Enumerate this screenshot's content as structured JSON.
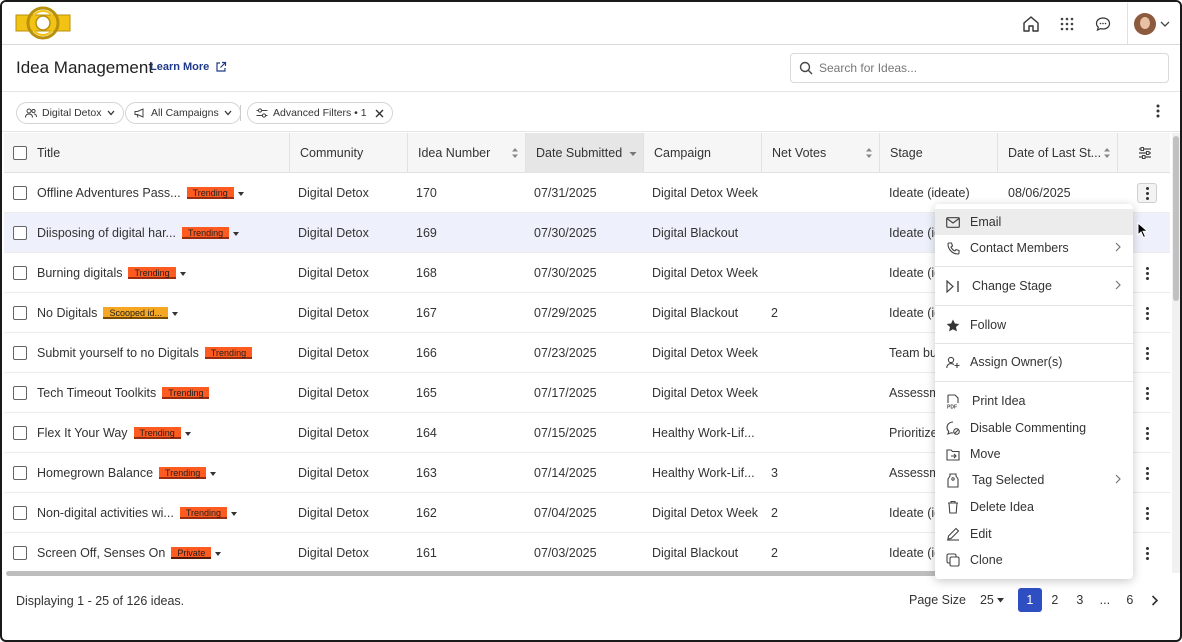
{
  "nav": {
    "home_icon": "home-icon",
    "apps_icon": "grid-icon",
    "chat_icon": "chat-icon"
  },
  "header": {
    "title": "Idea Management",
    "learn_more": "Learn More",
    "search_placeholder": "Search for Ideas..."
  },
  "filters": {
    "community": "Digital Detox",
    "campaigns": "All Campaigns",
    "advanced": "Advanced Filters • 1"
  },
  "columns": [
    "Title",
    "Community",
    "Idea Number",
    "Date Submitted",
    "Campaign",
    "Net Votes",
    "Stage",
    "Date of Last St..."
  ],
  "rows": [
    {
      "title": "Offline Adventures Pass...",
      "tag": "Trending",
      "community": "Digital Detox",
      "number": "170",
      "date": "07/31/2025",
      "campaign": "Digital Detox Week",
      "votes": "",
      "stage": "Ideate (ideate)",
      "last": "08/06/2025"
    },
    {
      "title": "Diisposing of digital har...",
      "tag": "Trending",
      "community": "Digital Detox",
      "number": "169",
      "date": "07/30/2025",
      "campaign": "Digital Blackout",
      "votes": "",
      "stage": "Ideate (ic",
      "last": ""
    },
    {
      "title": "Burning digitals",
      "tag": "Trending",
      "community": "Digital Detox",
      "number": "168",
      "date": "07/30/2025",
      "campaign": "Digital Detox Week",
      "votes": "",
      "stage": "Ideate (ic",
      "last": ""
    },
    {
      "title": "No Digitals",
      "tag": "Scooped id...",
      "community": "Digital Detox",
      "number": "167",
      "date": "07/29/2025",
      "campaign": "Digital Blackout",
      "votes": "2",
      "stage": "Ideate (ic",
      "last": ""
    },
    {
      "title": "Submit yourself to no Digitals",
      "tag": "Trending",
      "community": "Digital Detox",
      "number": "166",
      "date": "07/23/2025",
      "campaign": "Digital Detox Week",
      "votes": "",
      "stage": "Team bu",
      "last": ""
    },
    {
      "title": "Tech Timeout Toolkits",
      "tag": "Trending",
      "community": "Digital Detox",
      "number": "165",
      "date": "07/17/2025",
      "campaign": "Digital Detox Week",
      "votes": "",
      "stage": "Assessm",
      "last": ""
    },
    {
      "title": "Flex It Your Way",
      "tag": "Trending",
      "community": "Digital Detox",
      "number": "164",
      "date": "07/15/2025",
      "campaign": "Healthy Work-Lif...",
      "votes": "",
      "stage": "Prioritize",
      "last": ""
    },
    {
      "title": "Homegrown Balance",
      "tag": "Trending",
      "community": "Digital Detox",
      "number": "163",
      "date": "07/14/2025",
      "campaign": "Healthy Work-Lif...",
      "votes": "3",
      "stage": "Assessm",
      "last": ""
    },
    {
      "title": "Non-digital activities wi...",
      "tag": "Trending",
      "community": "Digital Detox",
      "number": "162",
      "date": "07/04/2025",
      "campaign": "Digital Detox Week",
      "votes": "2",
      "stage": "Ideate (ic",
      "last": ""
    },
    {
      "title": "Screen Off, Senses On",
      "tag": "Private",
      "community": "Digital Detox",
      "number": "161",
      "date": "07/03/2025",
      "campaign": "Digital Blackout",
      "votes": "2",
      "stage": "Ideate (ic",
      "last": ""
    }
  ],
  "footer": {
    "displaying": "Displaying 1 - 25 of 126 ideas.",
    "page_size_label": "Page Size",
    "page_size": "25",
    "pages": [
      "1",
      "2",
      "3",
      "...",
      "6"
    ]
  },
  "menu": [
    {
      "label": "Email",
      "icon": "email-icon"
    },
    {
      "label": "Contact Members",
      "icon": "phone-icon"
    },
    {
      "label": "Change Stage",
      "icon": "stage-icon"
    },
    {
      "label": "Follow",
      "icon": "star-icon"
    },
    {
      "label": "Assign Owner(s)",
      "icon": "assign-owner-icon"
    },
    {
      "label": "Print Idea",
      "icon": "pdf-icon"
    },
    {
      "label": "Disable Commenting",
      "icon": "comment-off-icon"
    },
    {
      "label": "Move",
      "icon": "move-icon"
    },
    {
      "label": "Tag Selected",
      "icon": "tag-icon"
    },
    {
      "label": "Delete Idea",
      "icon": "trash-icon"
    },
    {
      "label": "Edit",
      "icon": "pencil-icon"
    },
    {
      "label": "Clone",
      "icon": "clone-icon"
    }
  ],
  "colors": {
    "accent": "#2f4ec2",
    "trending": "#ff5a1f",
    "scooped": "#f5a623",
    "selected_row": "#eef1fb"
  }
}
